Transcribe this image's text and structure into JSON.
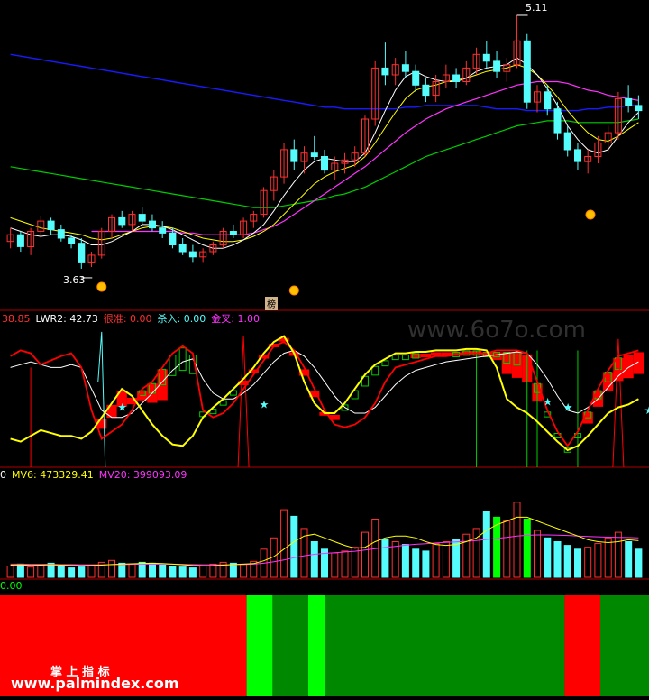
{
  "colors": {
    "bg": "#000000",
    "up": "#ff3030",
    "down": "#54fcfc",
    "ma_white": "#ffffff",
    "ma_yellow": "#ffff00",
    "ma_magenta": "#ff33ff",
    "ma_green": "#00cc00",
    "ma_blue": "#1a1aff",
    "separator": "#b00000",
    "band_red": "#ff0000",
    "band_dark_green": "#008800",
    "band_bright_green": "#00ff00",
    "kdj_red": "#ff0000",
    "kdj_white": "#ffffff",
    "kdj_yellow": "#ffff00",
    "kdj_cyan": "#54fcfc",
    "kdj_green": "#00cc00",
    "gold": "#ffc000"
  },
  "price_panel": {
    "high_label": "5.11",
    "low_label": "3.63",
    "marker_label": "榜"
  },
  "kdj_panel": {
    "legend": [
      {
        "text": "38.85",
        "color": "#ff3030"
      },
      {
        "text": "LWR2: 42.73",
        "color": "#ffffff"
      },
      {
        "text": "很准: 0.00",
        "color": "#ff3030"
      },
      {
        "text": "杀入: 0.00",
        "color": "#54fcfc"
      },
      {
        "text": "金叉: 1.00",
        "color": "#ff33ff"
      }
    ],
    "watermark": "www.6o7o.com"
  },
  "volume_panel": {
    "legend": [
      {
        "text": "0",
        "color": "#ffffff"
      },
      {
        "text": "MV6: 473329.41",
        "color": "#ffff00"
      },
      {
        "text": "MV20: 399093.09",
        "color": "#ff33ff"
      }
    ]
  },
  "band_panel": {
    "legend": "0.00",
    "brand_cn": "掌 上 指 标",
    "brand_url": "www.palmindex.com"
  },
  "chart_data": {
    "type": "candlestick",
    "ohlc": [
      [
        3.78,
        3.86,
        3.74,
        3.82
      ],
      [
        3.82,
        3.84,
        3.72,
        3.75
      ],
      [
        3.75,
        3.86,
        3.7,
        3.84
      ],
      [
        3.84,
        3.93,
        3.8,
        3.9
      ],
      [
        3.9,
        3.92,
        3.82,
        3.85
      ],
      [
        3.85,
        3.88,
        3.78,
        3.8
      ],
      [
        3.8,
        3.82,
        3.74,
        3.77
      ],
      [
        3.77,
        3.8,
        3.62,
        3.66
      ],
      [
        3.66,
        3.72,
        3.63,
        3.7
      ],
      [
        3.7,
        3.86,
        3.68,
        3.84
      ],
      [
        3.84,
        3.94,
        3.8,
        3.92
      ],
      [
        3.92,
        3.96,
        3.86,
        3.88
      ],
      [
        3.88,
        3.96,
        3.84,
        3.94
      ],
      [
        3.94,
        3.98,
        3.88,
        3.9
      ],
      [
        3.9,
        3.94,
        3.84,
        3.86
      ],
      [
        3.86,
        3.9,
        3.8,
        3.83
      ],
      [
        3.83,
        3.86,
        3.74,
        3.76
      ],
      [
        3.76,
        3.8,
        3.7,
        3.72
      ],
      [
        3.72,
        3.76,
        3.66,
        3.69
      ],
      [
        3.69,
        3.74,
        3.66,
        3.72
      ],
      [
        3.72,
        3.78,
        3.7,
        3.76
      ],
      [
        3.76,
        3.86,
        3.74,
        3.84
      ],
      [
        3.84,
        3.88,
        3.8,
        3.82
      ],
      [
        3.82,
        3.92,
        3.8,
        3.9
      ],
      [
        3.9,
        3.96,
        3.86,
        3.94
      ],
      [
        3.94,
        4.1,
        3.92,
        4.08
      ],
      [
        4.08,
        4.2,
        4.02,
        4.16
      ],
      [
        4.16,
        4.36,
        4.12,
        4.32
      ],
      [
        4.32,
        4.38,
        4.2,
        4.25
      ],
      [
        4.25,
        4.34,
        4.18,
        4.3
      ],
      [
        4.3,
        4.4,
        4.26,
        4.28
      ],
      [
        4.28,
        4.32,
        4.18,
        4.2
      ],
      [
        4.2,
        4.28,
        4.14,
        4.24
      ],
      [
        4.24,
        4.3,
        4.18,
        4.26
      ],
      [
        4.26,
        4.34,
        4.22,
        4.3
      ],
      [
        4.3,
        4.52,
        4.28,
        4.5
      ],
      [
        4.5,
        4.84,
        4.46,
        4.8
      ],
      [
        4.8,
        4.95,
        4.7,
        4.76
      ],
      [
        4.76,
        4.86,
        4.7,
        4.82
      ],
      [
        4.82,
        4.9,
        4.74,
        4.78
      ],
      [
        4.78,
        4.82,
        4.66,
        4.7
      ],
      [
        4.7,
        4.74,
        4.6,
        4.64
      ],
      [
        4.64,
        4.76,
        4.6,
        4.72
      ],
      [
        4.72,
        4.82,
        4.68,
        4.76
      ],
      [
        4.76,
        4.8,
        4.68,
        4.72
      ],
      [
        4.72,
        4.84,
        4.7,
        4.8
      ],
      [
        4.8,
        4.92,
        4.76,
        4.88
      ],
      [
        4.88,
        4.96,
        4.8,
        4.84
      ],
      [
        4.84,
        4.9,
        4.74,
        4.78
      ],
      [
        4.78,
        4.86,
        4.72,
        4.82
      ],
      [
        4.82,
        5.11,
        4.8,
        4.96
      ],
      [
        4.96,
        5.0,
        4.56,
        4.6
      ],
      [
        4.6,
        4.7,
        4.54,
        4.66
      ],
      [
        4.66,
        4.7,
        4.52,
        4.56
      ],
      [
        4.56,
        4.6,
        4.38,
        4.42
      ],
      [
        4.42,
        4.46,
        4.28,
        4.32
      ],
      [
        4.32,
        4.36,
        4.2,
        4.25
      ],
      [
        4.25,
        4.32,
        4.18,
        4.28
      ],
      [
        4.28,
        4.4,
        4.24,
        4.36
      ],
      [
        4.36,
        4.46,
        4.3,
        4.42
      ],
      [
        4.42,
        4.66,
        4.38,
        4.62
      ],
      [
        4.62,
        4.7,
        4.54,
        4.58
      ],
      [
        4.58,
        4.64,
        4.5,
        4.55
      ]
    ],
    "ma_white": [
      3.86,
      3.84,
      3.82,
      3.81,
      3.82,
      3.82,
      3.81,
      3.79,
      3.76,
      3.76,
      3.78,
      3.81,
      3.84,
      3.88,
      3.88,
      3.87,
      3.85,
      3.82,
      3.79,
      3.76,
      3.74,
      3.74,
      3.76,
      3.79,
      3.83,
      3.88,
      3.96,
      4.05,
      4.13,
      4.2,
      4.25,
      4.27,
      4.26,
      4.25,
      4.25,
      4.3,
      4.42,
      4.55,
      4.67,
      4.75,
      4.78,
      4.75,
      4.73,
      4.72,
      4.72,
      4.74,
      4.78,
      4.8,
      4.81,
      4.82,
      4.86,
      4.82,
      4.76,
      4.68,
      4.58,
      4.46,
      4.38,
      4.32,
      4.3,
      4.32,
      4.4,
      4.48,
      4.54
    ],
    "ma_yellow": [
      3.92,
      3.9,
      3.88,
      3.86,
      3.85,
      3.84,
      3.83,
      3.82,
      3.8,
      3.79,
      3.8,
      3.82,
      3.84,
      3.86,
      3.87,
      3.87,
      3.86,
      3.84,
      3.82,
      3.8,
      3.79,
      3.78,
      3.78,
      3.79,
      3.81,
      3.84,
      3.88,
      3.94,
      4.0,
      4.06,
      4.12,
      4.16,
      4.19,
      4.21,
      4.23,
      4.28,
      4.36,
      4.45,
      4.54,
      4.62,
      4.67,
      4.69,
      4.7,
      4.72,
      4.73,
      4.74,
      4.76,
      4.78,
      4.79,
      4.8,
      4.82,
      4.8,
      4.76,
      4.7,
      4.63,
      4.55,
      4.48,
      4.42,
      4.38,
      4.37,
      4.4,
      4.44,
      4.48
    ],
    "ma_magenta": [
      null,
      null,
      null,
      null,
      null,
      null,
      null,
      null,
      3.84,
      3.84,
      3.84,
      3.84,
      3.84,
      3.84,
      3.84,
      3.84,
      3.84,
      3.83,
      3.83,
      3.82,
      3.82,
      3.82,
      3.82,
      3.82,
      3.83,
      3.85,
      3.87,
      3.9,
      3.94,
      3.98,
      4.02,
      4.06,
      4.1,
      4.14,
      4.18,
      4.22,
      4.27,
      4.32,
      4.37,
      4.42,
      4.46,
      4.5,
      4.53,
      4.56,
      4.58,
      4.6,
      4.62,
      4.64,
      4.66,
      4.68,
      4.7,
      4.71,
      4.72,
      4.72,
      4.72,
      4.71,
      4.69,
      4.67,
      4.66,
      4.64,
      4.63,
      4.62,
      4.61
    ],
    "ma_green": [
      4.22,
      4.21,
      4.2,
      4.19,
      4.18,
      4.17,
      4.16,
      4.15,
      4.14,
      4.13,
      4.12,
      4.11,
      4.1,
      4.09,
      4.08,
      4.07,
      4.06,
      4.05,
      4.04,
      4.03,
      4.02,
      4.01,
      4.0,
      3.99,
      3.98,
      3.98,
      3.98,
      3.99,
      4.0,
      4.01,
      4.02,
      4.03,
      4.05,
      4.06,
      4.08,
      4.1,
      4.13,
      4.16,
      4.19,
      4.22,
      4.25,
      4.28,
      4.3,
      4.32,
      4.34,
      4.36,
      4.38,
      4.4,
      4.42,
      4.44,
      4.46,
      4.47,
      4.48,
      4.49,
      4.49,
      4.49,
      4.48,
      4.48,
      4.48,
      4.48,
      4.48,
      4.49,
      4.5
    ],
    "ma_blue": [
      4.88,
      4.87,
      4.86,
      4.85,
      4.84,
      4.83,
      4.82,
      4.81,
      4.8,
      4.79,
      4.78,
      4.77,
      4.76,
      4.75,
      4.74,
      4.73,
      4.72,
      4.71,
      4.7,
      4.69,
      4.68,
      4.67,
      4.66,
      4.65,
      4.64,
      4.63,
      4.62,
      4.61,
      4.6,
      4.59,
      4.58,
      4.57,
      4.57,
      4.56,
      4.56,
      4.56,
      4.56,
      4.56,
      4.56,
      4.57,
      4.57,
      4.58,
      4.58,
      4.58,
      4.58,
      4.58,
      4.58,
      4.57,
      4.56,
      4.56,
      4.56,
      4.55,
      4.55,
      4.55,
      4.55,
      4.55,
      4.55,
      4.56,
      4.56,
      4.57,
      4.57,
      4.58,
      4.58
    ],
    "price_range": [
      3.45,
      5.2
    ],
    "kdj": {
      "range": [
        0,
        100
      ],
      "red": [
        78,
        82,
        80,
        72,
        75,
        78,
        80,
        70,
        40,
        20,
        25,
        30,
        40,
        55,
        60,
        70,
        80,
        85,
        80,
        40,
        35,
        38,
        45,
        55,
        65,
        75,
        85,
        88,
        82,
        70,
        55,
        40,
        30,
        28,
        30,
        35,
        45,
        60,
        70,
        72,
        74,
        76,
        78,
        78,
        79,
        80,
        80,
        80,
        82,
        82,
        82,
        80,
        60,
        40,
        25,
        15,
        25,
        40,
        55,
        68,
        78,
        80,
        82
      ],
      "white": [
        70,
        72,
        74,
        72,
        70,
        70,
        72,
        70,
        55,
        40,
        35,
        35,
        38,
        45,
        52,
        60,
        68,
        74,
        76,
        62,
        52,
        48,
        48,
        52,
        58,
        66,
        74,
        80,
        82,
        78,
        70,
        60,
        50,
        42,
        38,
        38,
        42,
        50,
        58,
        64,
        68,
        70,
        72,
        74,
        75,
        76,
        77,
        78,
        79,
        80,
        81,
        80,
        72,
        62,
        50,
        40,
        38,
        42,
        48,
        56,
        64,
        70,
        74
      ],
      "yellow": [
        20,
        18,
        22,
        26,
        24,
        22,
        22,
        20,
        25,
        35,
        45,
        55,
        50,
        40,
        30,
        22,
        16,
        15,
        22,
        35,
        42,
        48,
        55,
        62,
        70,
        80,
        88,
        92,
        80,
        60,
        45,
        38,
        38,
        45,
        55,
        65,
        72,
        76,
        80,
        80,
        81,
        81,
        82,
        82,
        82,
        83,
        83,
        82,
        70,
        48,
        42,
        38,
        32,
        25,
        18,
        12,
        15,
        22,
        30,
        38,
        42,
        44,
        48
      ],
      "cyan_spike_index": 9,
      "red_spike_index": 23,
      "red_spike_index_2": 60,
      "green_vlines": [
        46,
        51,
        52,
        56
      ],
      "stars": [
        [
          11,
          42
        ],
        [
          25,
          44
        ],
        [
          53,
          46
        ],
        [
          55,
          42
        ],
        [
          63,
          40
        ]
      ],
      "cloud_ranges": [
        [
          9,
          15,
          "red"
        ],
        [
          23,
          32,
          "red"
        ],
        [
          40,
          52,
          "red"
        ],
        [
          57,
          63,
          "red"
        ],
        [
          13,
          22,
          "green"
        ],
        [
          33,
          40,
          "green"
        ],
        [
          44,
          50,
          "green"
        ],
        [
          52,
          60,
          "green"
        ]
      ]
    },
    "volume": {
      "range": [
        0,
        1000000
      ],
      "values": [
        120000,
        140000,
        110000,
        130000,
        150000,
        120000,
        100000,
        110000,
        130000,
        160000,
        180000,
        150000,
        140000,
        160000,
        150000,
        130000,
        120000,
        110000,
        100000,
        120000,
        140000,
        160000,
        150000,
        140000,
        170000,
        300000,
        420000,
        720000,
        650000,
        520000,
        380000,
        300000,
        260000,
        280000,
        320000,
        480000,
        620000,
        400000,
        380000,
        350000,
        300000,
        280000,
        360000,
        380000,
        400000,
        460000,
        520000,
        700000,
        640000,
        600000,
        800000,
        620000,
        500000,
        420000,
        380000,
        340000,
        300000,
        320000,
        360000,
        420000,
        480000,
        380000,
        300000
      ],
      "up": [
        true,
        false,
        true,
        true,
        false,
        false,
        false,
        false,
        true,
        true,
        true,
        false,
        true,
        false,
        false,
        false,
        false,
        false,
        false,
        true,
        true,
        true,
        false,
        true,
        true,
        true,
        true,
        true,
        false,
        true,
        false,
        false,
        true,
        true,
        true,
        true,
        true,
        false,
        true,
        false,
        false,
        false,
        true,
        true,
        false,
        true,
        true,
        false,
        false,
        true,
        true,
        false,
        true,
        false,
        false,
        false,
        false,
        true,
        true,
        true,
        true,
        false,
        false
      ],
      "mv6": [
        130000,
        132000,
        128000,
        130000,
        134000,
        130000,
        126000,
        124000,
        126000,
        130000,
        136000,
        140000,
        144000,
        148000,
        150000,
        146000,
        140000,
        134000,
        126000,
        122000,
        124000,
        130000,
        136000,
        140000,
        146000,
        176000,
        220000,
        300000,
        380000,
        440000,
        460000,
        420000,
        380000,
        340000,
        310000,
        320000,
        380000,
        420000,
        440000,
        440000,
        420000,
        380000,
        350000,
        340000,
        350000,
        380000,
        420000,
        500000,
        560000,
        600000,
        640000,
        640000,
        600000,
        560000,
        520000,
        480000,
        440000,
        400000,
        380000,
        370000,
        380000,
        400000,
        390000
      ],
      "mv20": [
        140000,
        140000,
        138000,
        138000,
        138000,
        136000,
        136000,
        134000,
        134000,
        134000,
        136000,
        136000,
        138000,
        140000,
        140000,
        140000,
        140000,
        138000,
        136000,
        134000,
        134000,
        134000,
        136000,
        136000,
        140000,
        150000,
        165000,
        185000,
        210000,
        230000,
        245000,
        255000,
        262000,
        270000,
        278000,
        290000,
        305000,
        318000,
        330000,
        342000,
        352000,
        358000,
        366000,
        372000,
        378000,
        384000,
        392000,
        404000,
        416000,
        426000,
        440000,
        448000,
        452000,
        452000,
        450000,
        446000,
        440000,
        436000,
        432000,
        428000,
        426000,
        424000,
        420000
      ]
    },
    "bands": [
      {
        "from": 0.0,
        "to": 0.38,
        "color": "red"
      },
      {
        "from": 0.38,
        "to": 0.42,
        "color": "bright_green"
      },
      {
        "from": 0.42,
        "to": 0.475,
        "color": "dark_green"
      },
      {
        "from": 0.475,
        "to": 0.5,
        "color": "bright_green"
      },
      {
        "from": 0.5,
        "to": 0.87,
        "color": "dark_green"
      },
      {
        "from": 0.87,
        "to": 0.925,
        "color": "red"
      },
      {
        "from": 0.925,
        "to": 1.0,
        "color": "dark_green"
      }
    ]
  }
}
